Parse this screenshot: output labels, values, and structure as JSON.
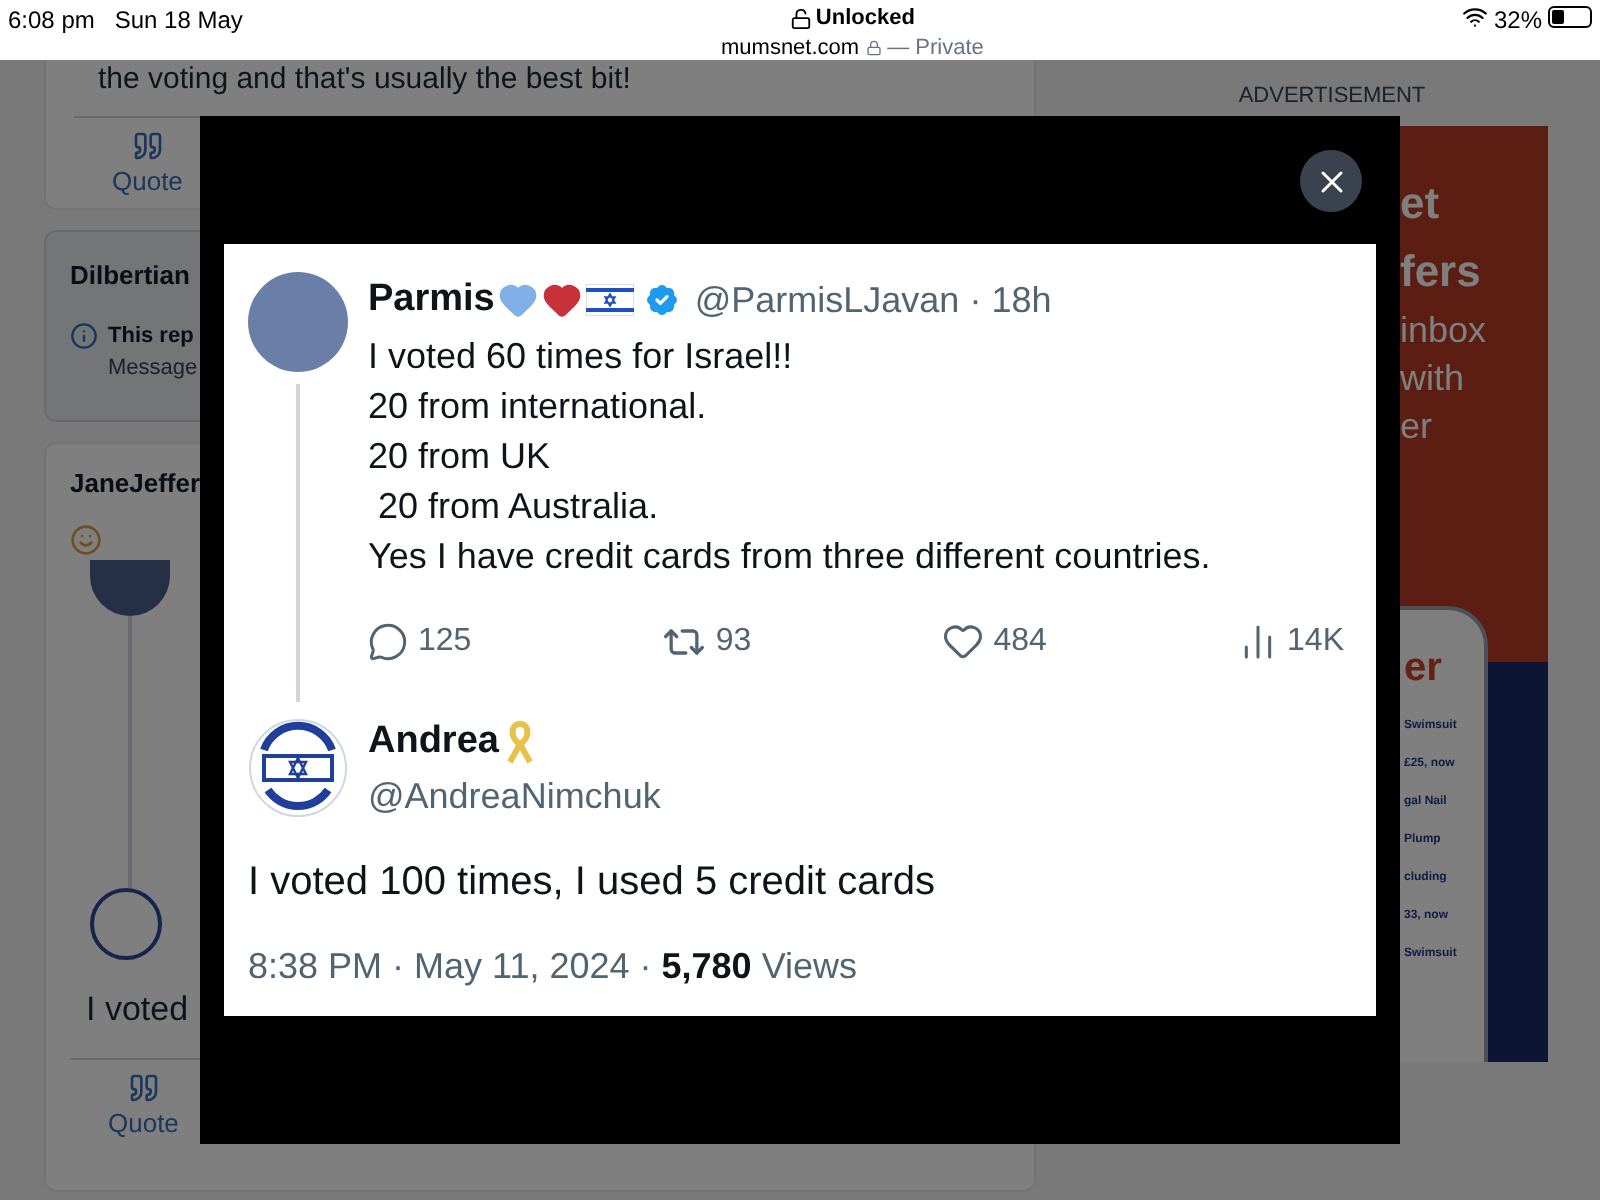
{
  "status_bar": {
    "time": "6:08 pm",
    "date": "Sun 18 May",
    "lock_label": "Unlocked",
    "url": "mumsnet.com",
    "privacy": "— Private",
    "battery": "32%"
  },
  "posts": [
    {
      "kind": "tail",
      "text": "the voting and that's usually the best bit!",
      "actions": [
        "Quote"
      ]
    },
    {
      "kind": "notice",
      "author": "Dilbertian",
      "notice": "This rep",
      "note": "Message"
    },
    {
      "kind": "embed",
      "author": "JaneJeffer",
      "embed_text": "I voted",
      "actions": [
        "Quote"
      ]
    }
  ],
  "advert": {
    "label": "ADVERTISEMENT",
    "headline": [
      "et",
      "fers",
      "inbox",
      "with",
      "er"
    ],
    "phone_title": "er",
    "phone_items": [
      "Swimsuit",
      "£25, now",
      "gal Nail",
      "Plump",
      "cluding",
      "33, now",
      "Swimsuit"
    ]
  },
  "lightbox": {
    "tweet": {
      "name": "Parmis",
      "handle": "@ParmisLJavan · 18h",
      "lines": [
        "I voted 60 times for Israel!!",
        "20 from international.",
        "20 from UK",
        " 20 from Australia.",
        "Yes I have credit cards from three different countries."
      ],
      "stats": [
        {
          "kind": "reply",
          "value": "125"
        },
        {
          "kind": "repost",
          "value": "93"
        },
        {
          "kind": "like",
          "value": "484"
        },
        {
          "kind": "views",
          "value": "14K"
        }
      ]
    },
    "reply": {
      "name": "Andrea",
      "handle": "@AndreaNimchuk",
      "text": "I voted 100 times, I used 5 credit cards",
      "footer": "8:38 PM · May 11, 2024 · **5,780** Views"
    }
  }
}
